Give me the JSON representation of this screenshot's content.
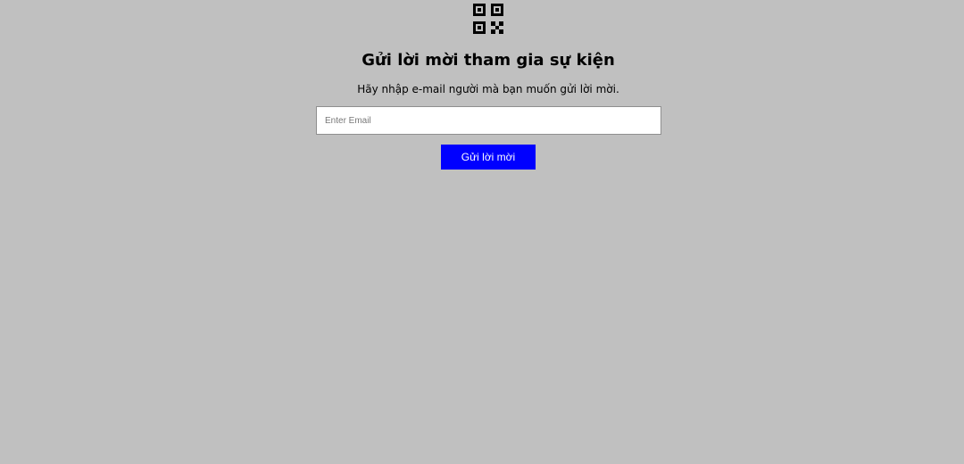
{
  "header": {
    "icon": "qr-code-icon",
    "title": "Gửi lời mời tham gia sự kiện",
    "subtitle": "Hãy nhập e-mail người mà bạn muốn gửi lời mời."
  },
  "form": {
    "email_placeholder": "Enter Email",
    "email_value": "",
    "submit_label": "Gửi lời mời"
  },
  "colors": {
    "background": "#c0c0c0",
    "button_bg": "#0000ff",
    "button_text": "#ffffff"
  }
}
